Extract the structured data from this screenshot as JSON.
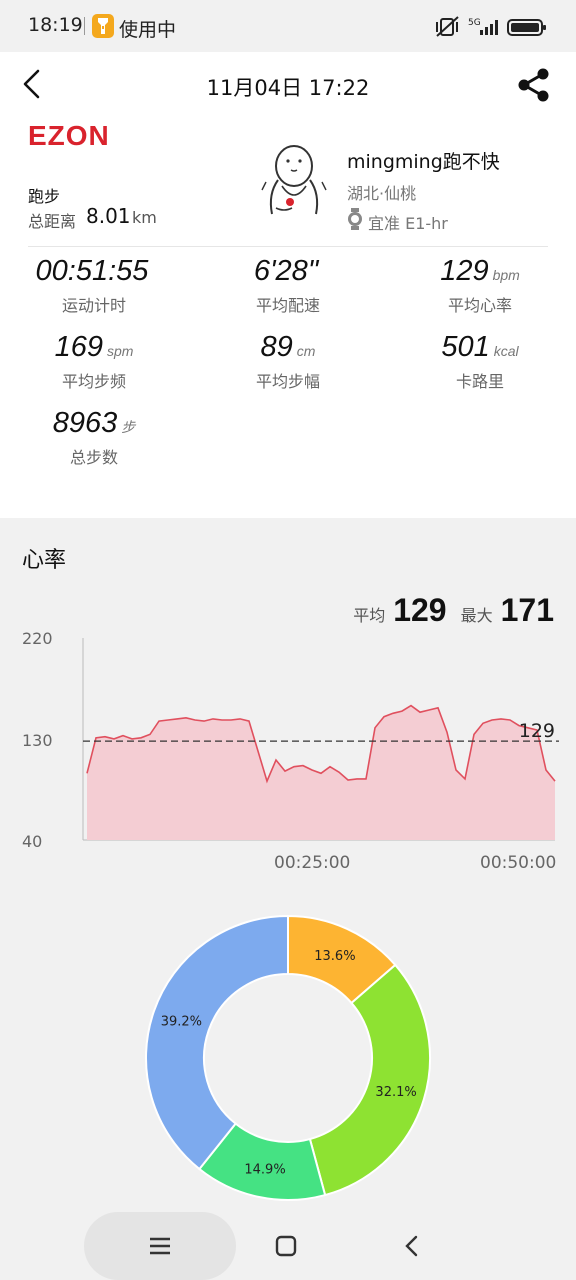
{
  "status_bar": {
    "time": "18:19",
    "in_use": "使用中",
    "network": "5G",
    "lamp_color": "#f4a81d"
  },
  "header": {
    "title": "11月04日 17:22",
    "back_icon": "chevron-left-icon",
    "share_icon": "share-icon"
  },
  "workout": {
    "brand": "EZON",
    "brand_color": "#d9232d",
    "sport": "跑步",
    "distance_label": "总距离",
    "distance_value": "8.01",
    "distance_unit": "km"
  },
  "user": {
    "name": "mingming跑不快",
    "location": "湖北·仙桃",
    "device": "宜准 E1-hr",
    "device_icon": "watch-icon"
  },
  "stats": [
    {
      "value": "00:51:55",
      "unit": "",
      "label": "运动计时"
    },
    {
      "value": "6'28\"",
      "unit": "",
      "label": "平均配速"
    },
    {
      "value": "129",
      "unit": "bpm",
      "label": "平均心率"
    },
    {
      "value": "169",
      "unit": "spm",
      "label": "平均步频"
    },
    {
      "value": "89",
      "unit": "cm",
      "label": "平均步幅"
    },
    {
      "value": "501",
      "unit": "kcal",
      "label": "卡路里"
    },
    {
      "value": "8963",
      "unit": "步",
      "label": "总步数"
    }
  ],
  "heart_rate": {
    "title": "心率",
    "avg_label": "平均",
    "avg_value": "129",
    "max_label": "最大",
    "max_value": "171",
    "line_color": "#e0505e",
    "fill_color": "#f4cdd3"
  },
  "chart_data": [
    {
      "type": "area",
      "title": "心率",
      "xlabel": "",
      "ylabel": "",
      "ylim": [
        40,
        220
      ],
      "y_ticks": [
        "220",
        "130",
        "40"
      ],
      "x_ticks": [
        "00:25:00",
        "00:50:00"
      ],
      "xlim_minutes": [
        0,
        52
      ],
      "reference_line": {
        "value": 129,
        "label": "129",
        "style": "dashed"
      },
      "series": [
        {
          "x": [
            0,
            1,
            2,
            3,
            4,
            5,
            6,
            7,
            8,
            9,
            10,
            11,
            12,
            13,
            14,
            15,
            16,
            17,
            18,
            19,
            20,
            21,
            22,
            23,
            24,
            25,
            26,
            27,
            28,
            29,
            30,
            31,
            32,
            33,
            34,
            35,
            36,
            37,
            38,
            39,
            40,
            41,
            42,
            43,
            44,
            45,
            46,
            47,
            48,
            49,
            50,
            51,
            52
          ],
          "values": [
            100,
            132,
            133,
            131,
            134,
            131,
            132,
            135,
            147,
            148,
            149,
            150,
            148,
            147,
            149,
            148,
            148,
            149,
            147,
            120,
            93,
            112,
            102,
            106,
            107,
            103,
            100,
            106,
            101,
            94,
            95,
            95,
            141,
            151,
            154,
            156,
            161,
            155,
            157,
            159,
            137,
            103,
            95,
            135,
            145,
            148,
            149,
            148,
            143,
            141,
            139,
            103,
            93
          ]
        }
      ]
    },
    {
      "type": "pie",
      "donut": true,
      "labels": [
        "13.6%",
        "32.1%",
        "14.9%",
        "39.2%"
      ],
      "values": [
        13.6,
        32.1,
        14.9,
        39.2
      ],
      "colors": [
        "#fdb432",
        "#8ee232",
        "#45e283",
        "#7daaee"
      ]
    }
  ],
  "nav": {
    "menu_icon": "menu-icon",
    "home_icon": "home-icon",
    "back_icon": "back-triangle-icon"
  }
}
